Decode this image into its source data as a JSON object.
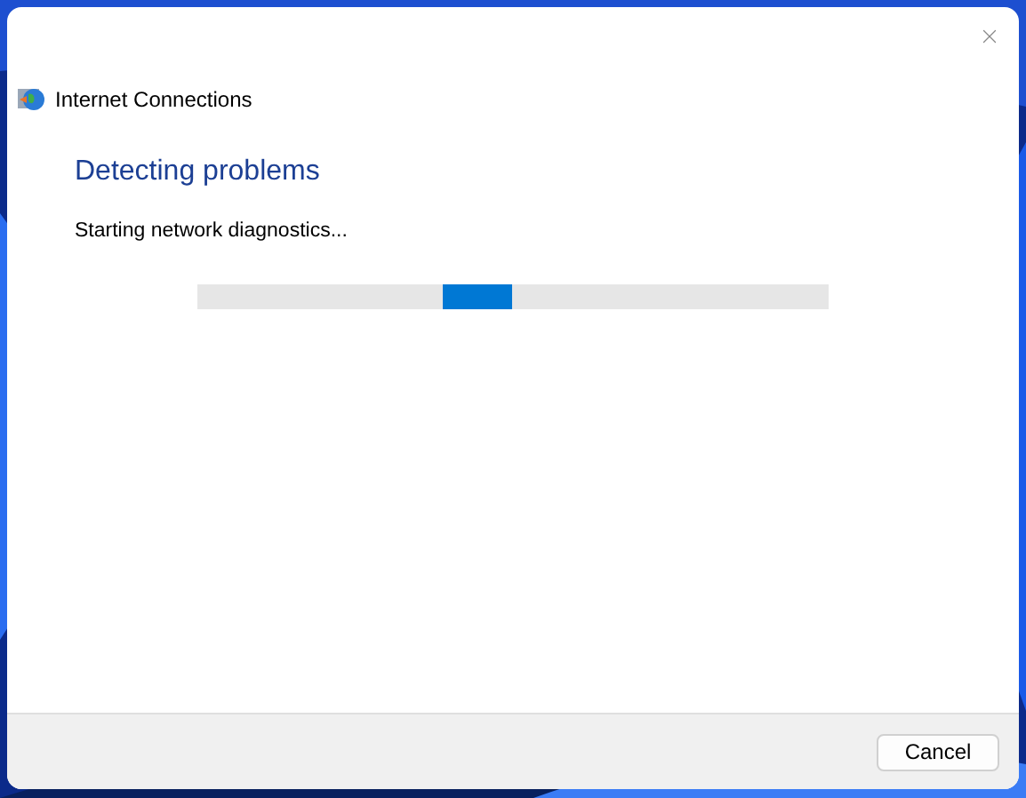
{
  "window": {
    "title": "Internet Connections"
  },
  "heading": "Detecting problems",
  "status": "Starting network diagnostics...",
  "progress": {
    "indeterminate": true
  },
  "buttons": [
    "Cancel"
  ]
}
